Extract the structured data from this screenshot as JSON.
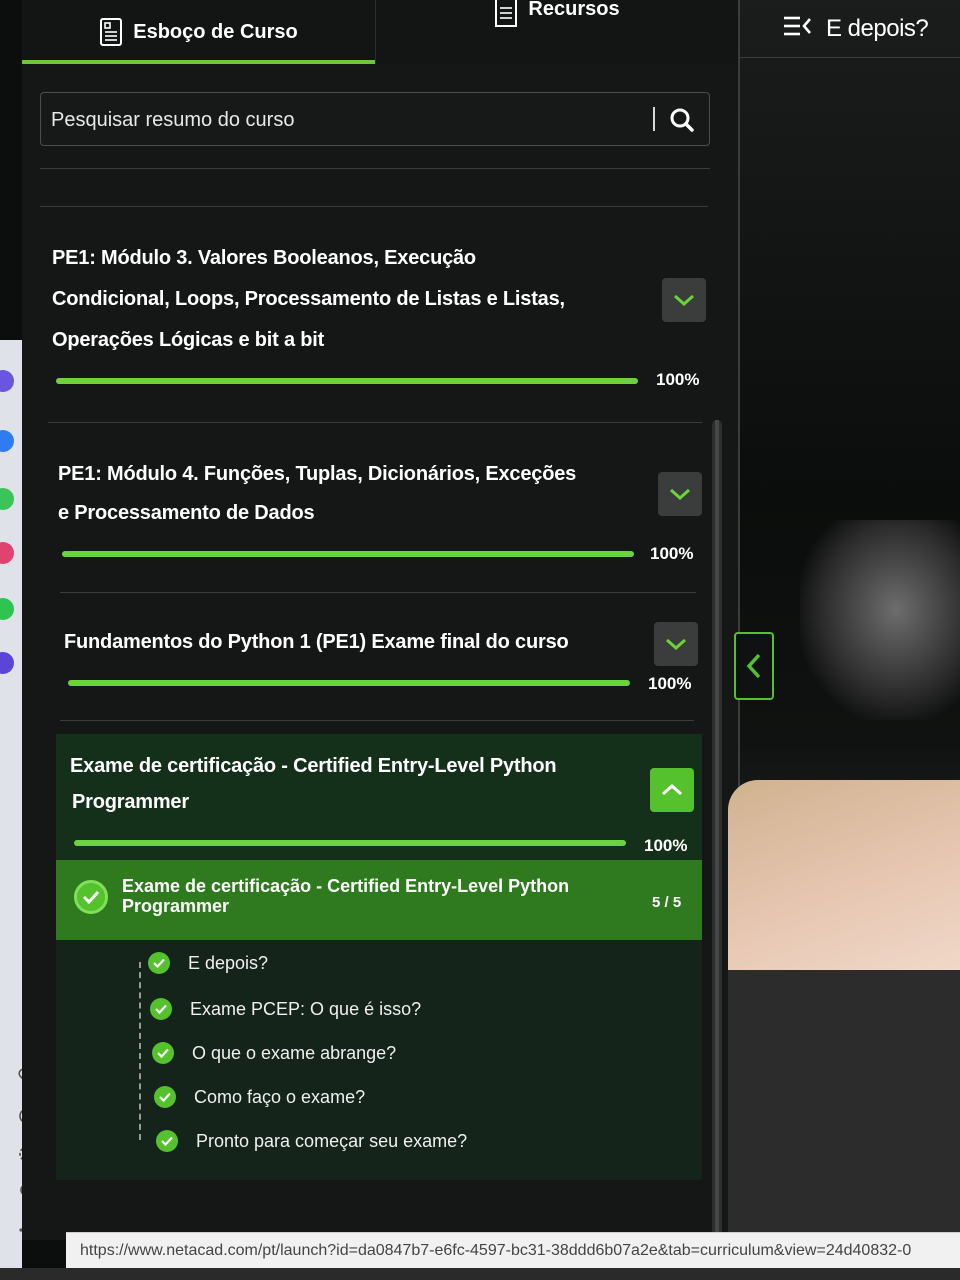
{
  "tabs": {
    "outline_label": "Esboço de Curso",
    "resources_label": "Recursos"
  },
  "search": {
    "placeholder": "Pesquisar resumo do curso"
  },
  "sections": [
    {
      "title_lines": [
        "PE1: Módulo 3. Valores Booleanos, Execução",
        "Condicional, Loops, Processamento de Listas e Listas,",
        "Operações Lógicas e bit a bit"
      ],
      "progress": 100,
      "progress_label": "100%",
      "expanded": false
    },
    {
      "title_lines": [
        "PE1: Módulo 4. Funções, Tuplas, Dicionários, Exceções",
        "e Processamento de Dados"
      ],
      "progress": 100,
      "progress_label": "100%",
      "expanded": false
    },
    {
      "title_lines": [
        "Fundamentos do Python 1 (PE1) Exame final do curso"
      ],
      "progress": 100,
      "progress_label": "100%",
      "expanded": false
    },
    {
      "title_lines": [
        "Exame de certificação - Certified Entry-Level Python",
        "Programmer"
      ],
      "progress": 100,
      "progress_label": "100%",
      "expanded": true
    }
  ],
  "subsection": {
    "title_lines": [
      "Exame de certificação - Certified Entry-Level Python",
      "Programmer"
    ],
    "count": "5 / 5"
  },
  "lessons": [
    "E depois?",
    "Exame PCEP: O que é isso?",
    "O que o exame abrange?",
    "Como faço o exame?",
    "Pronto para começar seu exame?"
  ],
  "right_header": {
    "title": "E depois?"
  },
  "status": {
    "url": "https://www.netacad.com/pt/launch?id=da0847b7-e6fc-4597-bc31-38ddd6b07a2e&tab=curriculum&view=24d40832-0"
  },
  "colors": {
    "accent": "#55c22d",
    "progress": "#6cd33c",
    "panel_bg": "#141716",
    "active_bg": "#2f7a1f"
  },
  "icons": {
    "outline_tab": "outline-document-icon",
    "resources_tab": "resources-document-icon",
    "search": "search-icon",
    "chevron_down": "chevron-down-icon",
    "chevron_up": "chevron-up-icon",
    "check": "check-circle-icon",
    "menu_collapse": "menu-collapse-icon",
    "chevron_left": "chevron-left-icon"
  }
}
